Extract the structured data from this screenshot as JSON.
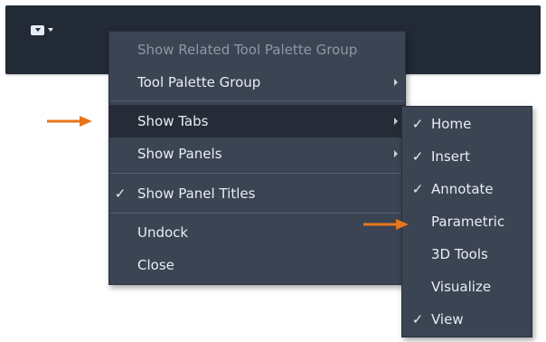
{
  "toolbar": {
    "dropdown_icon": "panel-dropdown-icon"
  },
  "context_menu": {
    "items": [
      {
        "label": "Show Related Tool Palette Group",
        "enabled": false,
        "checked": false,
        "has_submenu": false
      },
      {
        "label": "Tool Palette Group",
        "enabled": true,
        "checked": false,
        "has_submenu": true
      },
      {
        "label": "Show Tabs",
        "enabled": true,
        "checked": false,
        "has_submenu": true,
        "highlighted": true
      },
      {
        "label": "Show Panels",
        "enabled": true,
        "checked": false,
        "has_submenu": true
      },
      {
        "label": "Show Panel Titles",
        "enabled": true,
        "checked": true,
        "has_submenu": false
      },
      {
        "label": "Undock",
        "enabled": true,
        "checked": false,
        "has_submenu": false
      },
      {
        "label": "Close",
        "enabled": true,
        "checked": false,
        "has_submenu": false
      }
    ]
  },
  "tabs_submenu": {
    "items": [
      {
        "label": "Home",
        "checked": true
      },
      {
        "label": "Insert",
        "checked": true
      },
      {
        "label": "Annotate",
        "checked": true
      },
      {
        "label": "Parametric",
        "checked": false
      },
      {
        "label": "3D Tools",
        "checked": false
      },
      {
        "label": "Visualize",
        "checked": false
      },
      {
        "label": "View",
        "checked": true
      }
    ]
  },
  "glyphs": {
    "check": "✓"
  },
  "colors": {
    "menu_bg": "#3b4453",
    "menu_highlight": "#252c37",
    "toolbar_bg": "#222a36",
    "callout_arrow": "#e8761c",
    "text": "#e9edf3",
    "disabled_text": "#8e97a5"
  }
}
